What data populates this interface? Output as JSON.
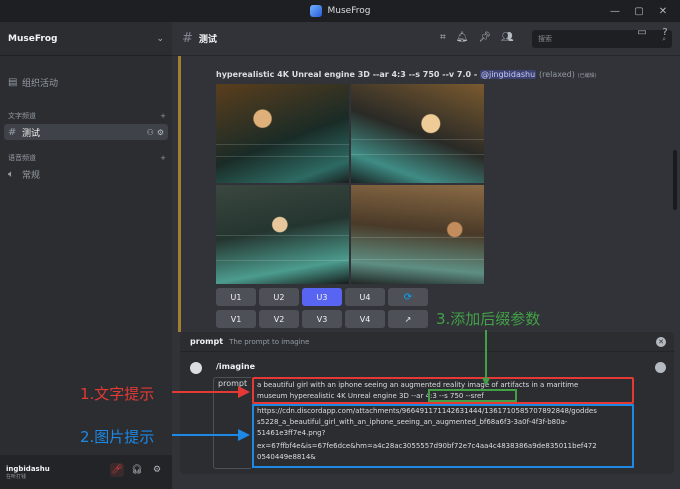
{
  "window": {
    "title": "MuseFrog"
  },
  "server": {
    "name": "MuseFrog"
  },
  "sidebar": {
    "items": [
      {
        "label": "组织活动",
        "icon": "calendar-icon"
      },
      {
        "label": "测试",
        "icon": "hash-icon"
      },
      {
        "label": "常规",
        "icon": "speaker-icon"
      }
    ],
    "categories": [
      "文字频道",
      "语音频道"
    ]
  },
  "user": {
    "name": "ingbidashu",
    "status": "在听打钱"
  },
  "channel": {
    "name": "测试"
  },
  "search": {
    "placeholder": "搜索"
  },
  "message": {
    "prompt": "hyperealistic 4K Unreal engine 3D --ar 4:3 --s 750 --v 7.0 -",
    "mention": "@jingbidashu",
    "mode": "(relaxed)",
    "edited": "(已编辑)"
  },
  "buttons": {
    "upscale": [
      "U1",
      "U2",
      "U3",
      "U4"
    ],
    "variation": [
      "V1",
      "V2",
      "V3",
      "V4"
    ],
    "selected": "U3"
  },
  "slash": {
    "name": "prompt",
    "description": "The prompt to imagine",
    "command": "/imagine",
    "field_label": "prompt",
    "text_lines": [
      "a beautiful girl with an iphone seeing an augmented reality image of artifacts in a maritime",
      "museum hyperealistic 4K Unreal engine 3D --ar 4:3 --s 750 --sref",
      "https://cdn.discordapp.com/attachments/966491171142631444/1361710585707892848/goddes",
      "s5228_a_beautiful_girl_with_an_iphone_seeing_an_augmented_bf68a6f3-3a0f-4f3f-b80a-",
      "51461e3ff7e4.png?",
      "ex=67ffbf4e&is=67fe6dce&hm=a4c28ac3055557d90bf72e7c4aa4c4838386a9de835011bef472",
      "0540449e8814&"
    ]
  },
  "annotations": {
    "text_prompt": "1.文字提示",
    "image_prompt": "2.图片提示",
    "suffix_params": "3.添加后缀参数"
  },
  "colors": {
    "red": "#e53935",
    "green": "#43a047",
    "blue": "#1e88e5",
    "accent": "#5865f2"
  }
}
